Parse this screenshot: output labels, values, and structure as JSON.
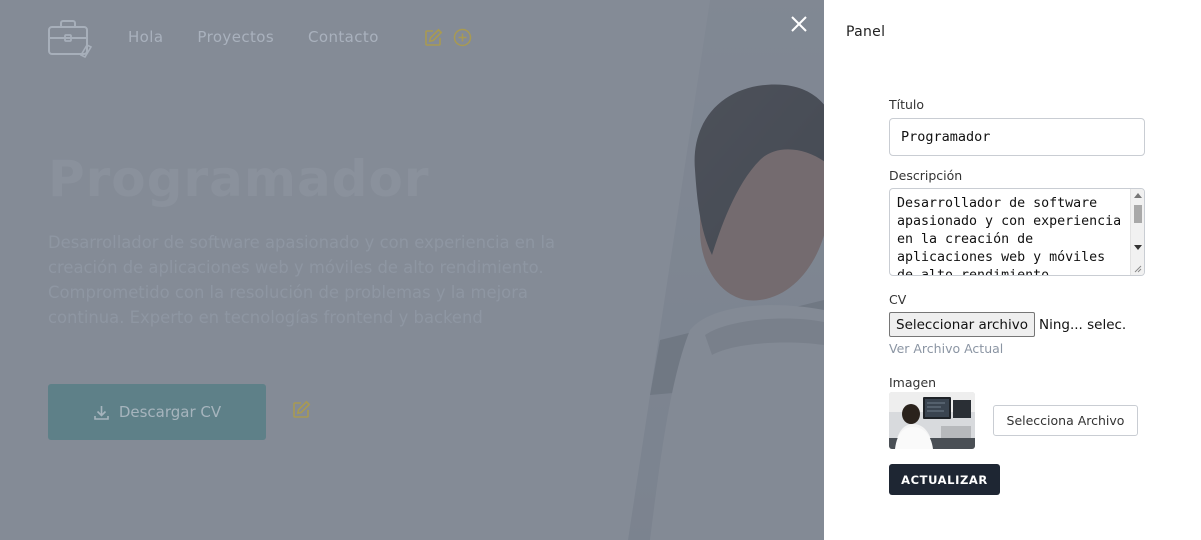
{
  "header": {
    "logo_icon": "briefcase-icon",
    "nav": [
      "Hola",
      "Proyectos",
      "Contacto"
    ],
    "edit_icon": "edit-icon",
    "add_icon": "plus-circle-icon"
  },
  "hero": {
    "title": "Programador",
    "description": "Desarrollador de software apasionado y con experiencia en la creación de aplicaciones web y móviles de alto rendimiento. Comprometido con la resolución de problemas y la mejora continua. Experto en tecnologías frontend y backend",
    "download_label": "Descargar CV",
    "download_icon": "download-icon"
  },
  "overlay": {
    "close_icon": "close-icon"
  },
  "panel": {
    "title": "Panel",
    "titulo_label": "Título",
    "titulo_value": "Programador",
    "descripcion_label": "Descripción",
    "descripcion_value": "Desarrollador de software apasionado y con experiencia en la creación de aplicaciones web y móviles de alto rendimiento. Comprometido",
    "cv_label": "CV",
    "cv_button": "Seleccionar archivo",
    "cv_status": "Ning... selec.",
    "ver_archivo": "Ver Archivo Actual",
    "imagen_label": "Imagen",
    "imagen_button": "Selecciona Archivo",
    "update_button": "ACTUALIZAR"
  },
  "colors": {
    "overlay": "#555e6e",
    "download_button": "#5e8088",
    "accent_icon": "#a89a52",
    "update_button": "#1e2633"
  }
}
